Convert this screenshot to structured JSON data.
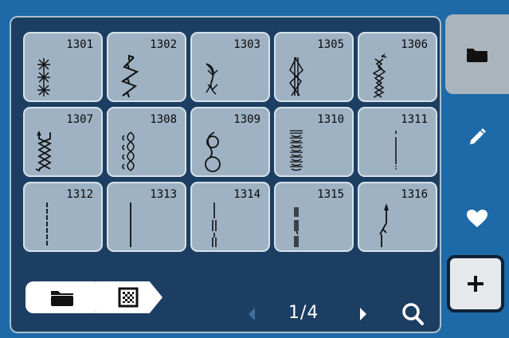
{
  "stitches": [
    {
      "number": "1301",
      "icon": "triple-asterisk-stitch-icon"
    },
    {
      "number": "1302",
      "icon": "zigzag-arrow-stitch-icon"
    },
    {
      "number": "1303",
      "icon": "wave-arrow-stitch-icon"
    },
    {
      "number": "1305",
      "icon": "lattice-stitch-icon"
    },
    {
      "number": "1306",
      "icon": "cross-chain-stitch-icon"
    },
    {
      "number": "1307",
      "icon": "bracket-zigzag-stitch-icon"
    },
    {
      "number": "1308",
      "icon": "loop-column-stitch-icon"
    },
    {
      "number": "1309",
      "icon": "double-loop-stitch-icon"
    },
    {
      "number": "1310",
      "icon": "satin-fill-stitch-icon"
    },
    {
      "number": "1311",
      "icon": "dotted-straight-stitch-icon"
    },
    {
      "number": "1312",
      "icon": "dashed-straight-stitch-icon"
    },
    {
      "number": "1313",
      "icon": "straight-stitch-icon"
    },
    {
      "number": "1314",
      "icon": "triple-straight-stitch-icon"
    },
    {
      "number": "1315",
      "icon": "heavy-triple-stitch-icon"
    },
    {
      "number": "1316",
      "icon": "tapered-start-stitch-icon"
    }
  ],
  "pager": {
    "text": "1/4"
  },
  "colors": {
    "background": "#1e6aa8",
    "panel": "#1c3e62",
    "tile": "#9eb2c3",
    "sideActive": "#aab4bc"
  },
  "sidebar": [
    "folder-icon",
    "pencil-icon",
    "heart-icon"
  ],
  "breadcrumb": [
    "folder-icon",
    "pattern-icon"
  ]
}
